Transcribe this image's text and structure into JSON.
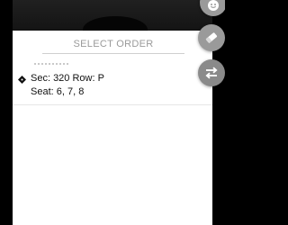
{
  "header": {
    "select_order_label": "SELECT ORDER"
  },
  "orders": [
    {
      "section_row": "Sec: 320 Row: P",
      "seats": "Seat: 6, 7, 8",
      "icon": "ticket-icon"
    }
  ],
  "actions": [
    {
      "icon": "smiley-icon"
    },
    {
      "icon": "eraser-icon"
    },
    {
      "icon": "swap-arrows-icon"
    }
  ],
  "colors": {
    "sheet_background": "#ffffff",
    "backdrop": "#000000",
    "fab_gray": "#9a9a9a",
    "select_order_text": "#9a9a9a"
  }
}
